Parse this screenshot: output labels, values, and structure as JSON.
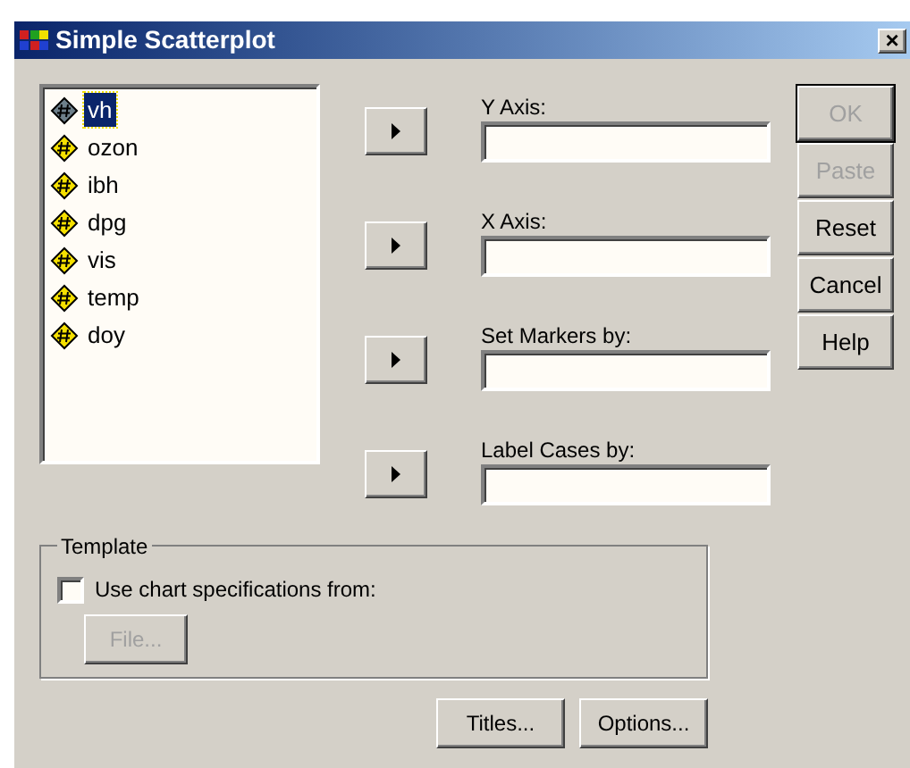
{
  "window": {
    "title": "Simple Scatterplot",
    "close": "×"
  },
  "variables": [
    {
      "name": "vh",
      "selected": true
    },
    {
      "name": "ozon",
      "selected": false
    },
    {
      "name": "ibh",
      "selected": false
    },
    {
      "name": "dpg",
      "selected": false
    },
    {
      "name": "vis",
      "selected": false
    },
    {
      "name": "temp",
      "selected": false
    },
    {
      "name": "doy",
      "selected": false
    }
  ],
  "targets": [
    {
      "label": "Y Axis:"
    },
    {
      "label": "X Axis:"
    },
    {
      "label": "Set Markers by:"
    },
    {
      "label": "Label Cases by:"
    }
  ],
  "buttons": [
    {
      "label": "OK",
      "disabled": true
    },
    {
      "label": "Paste",
      "disabled": true
    },
    {
      "label": "Reset",
      "disabled": false
    },
    {
      "label": "Cancel",
      "disabled": false
    },
    {
      "label": "Help",
      "disabled": false
    }
  ],
  "template": {
    "title": "Template",
    "checkbox": {
      "label": "Use chart specifications from:",
      "checked": false
    },
    "file_button": {
      "label": "File...",
      "disabled": true
    }
  },
  "bottom_buttons": [
    {
      "label": "Titles..."
    },
    {
      "label": "Options..."
    }
  ]
}
